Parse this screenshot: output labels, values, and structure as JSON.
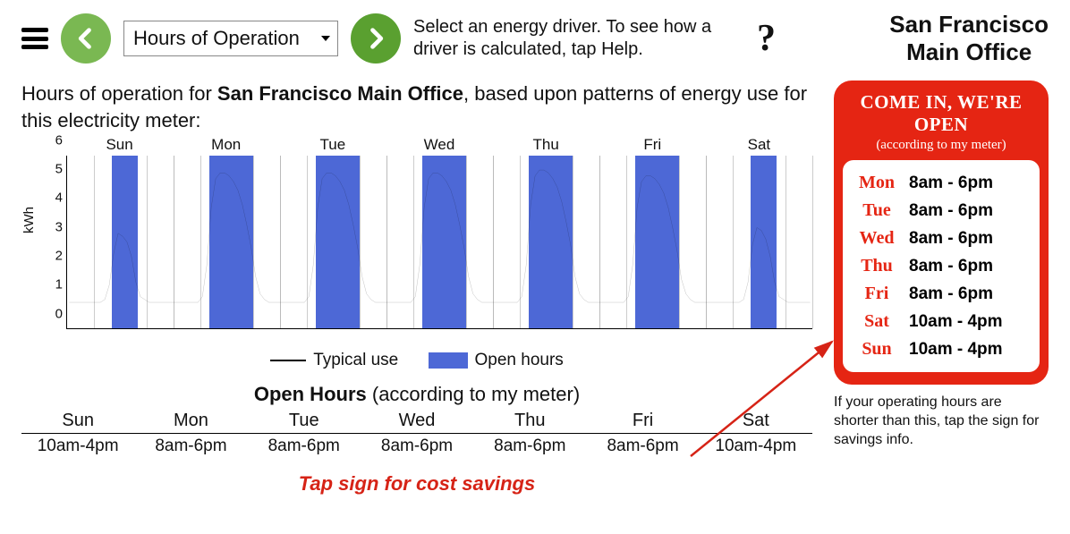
{
  "header": {
    "driver_selected": "Hours of Operation",
    "instructions": "Select an energy driver. To see how a driver is calculated, tap Help.",
    "site_line1": "San Francisco",
    "site_line2": "Main Office"
  },
  "description": {
    "prefix": "Hours of operation for ",
    "site": "San Francisco Main Office",
    "suffix": ", based upon patterns of energy use for this electricity meter:"
  },
  "chart_data": {
    "type": "line+bar",
    "ylabel": "kWh",
    "ylim": [
      0,
      6
    ],
    "yticks": [
      0,
      1,
      2,
      3,
      4,
      5,
      6
    ],
    "days": [
      "Sun",
      "Mon",
      "Tue",
      "Wed",
      "Thu",
      "Fri",
      "Sat"
    ],
    "hours_per_day": 24,
    "open_windows": [
      {
        "day": "Sun",
        "start": 10,
        "end": 16
      },
      {
        "day": "Mon",
        "start": 8,
        "end": 18
      },
      {
        "day": "Tue",
        "start": 8,
        "end": 18
      },
      {
        "day": "Wed",
        "start": 8,
        "end": 18
      },
      {
        "day": "Thu",
        "start": 8,
        "end": 18
      },
      {
        "day": "Fri",
        "start": 8,
        "end": 18
      },
      {
        "day": "Sat",
        "start": 10,
        "end": 16
      }
    ],
    "typical_use_hourly": {
      "Sun": [
        0.9,
        0.9,
        0.9,
        0.9,
        0.9,
        0.9,
        0.9,
        0.9,
        1.0,
        1.5,
        2.6,
        3.3,
        3.2,
        3.0,
        2.5,
        1.6,
        1.1,
        1.0,
        0.9,
        0.9,
        0.9,
        0.9,
        0.9,
        0.9
      ],
      "Mon": [
        0.9,
        0.9,
        0.9,
        0.9,
        0.9,
        0.9,
        1.1,
        2.2,
        4.2,
        5.2,
        5.4,
        5.4,
        5.3,
        5.1,
        4.8,
        4.3,
        3.6,
        2.8,
        1.8,
        1.2,
        1.0,
        0.9,
        0.9,
        0.9
      ],
      "Tue": [
        0.9,
        0.9,
        0.9,
        0.9,
        0.9,
        0.9,
        1.1,
        2.2,
        4.2,
        5.2,
        5.4,
        5.4,
        5.3,
        5.1,
        4.8,
        4.3,
        3.6,
        2.8,
        1.8,
        1.2,
        1.0,
        0.9,
        0.9,
        0.9
      ],
      "Wed": [
        0.9,
        0.9,
        0.9,
        0.9,
        0.9,
        0.9,
        1.1,
        2.2,
        4.2,
        5.2,
        5.4,
        5.4,
        5.3,
        5.1,
        4.8,
        4.3,
        3.6,
        2.8,
        1.8,
        1.2,
        1.0,
        0.9,
        0.9,
        0.9
      ],
      "Thu": [
        0.9,
        0.9,
        0.9,
        0.9,
        0.9,
        0.9,
        1.1,
        2.2,
        4.3,
        5.3,
        5.5,
        5.5,
        5.4,
        5.2,
        4.9,
        4.4,
        3.7,
        2.9,
        1.8,
        1.2,
        1.0,
        0.9,
        0.9,
        0.9
      ],
      "Fri": [
        0.9,
        0.9,
        0.9,
        0.9,
        0.9,
        0.9,
        1.1,
        2.2,
        4.2,
        5.1,
        5.3,
        5.3,
        5.2,
        5.0,
        4.7,
        4.2,
        3.5,
        2.7,
        1.7,
        1.2,
        1.0,
        0.9,
        0.9,
        0.9
      ],
      "Sat": [
        0.9,
        0.9,
        0.9,
        0.9,
        0.9,
        0.9,
        0.9,
        0.9,
        1.0,
        1.6,
        2.9,
        3.5,
        3.4,
        3.1,
        2.5,
        1.6,
        1.1,
        1.0,
        0.9,
        0.9,
        0.9,
        0.9,
        0.9,
        0.9
      ]
    },
    "legend": {
      "line": "Typical use",
      "bar": "Open hours"
    }
  },
  "open_hours_table": {
    "title_bold": "Open Hours",
    "title_rest": " (according to my meter)",
    "rows": [
      {
        "day": "Sun",
        "hours": "10am-4pm"
      },
      {
        "day": "Mon",
        "hours": "8am-6pm"
      },
      {
        "day": "Tue",
        "hours": "8am-6pm"
      },
      {
        "day": "Wed",
        "hours": "8am-6pm"
      },
      {
        "day": "Thu",
        "hours": "8am-6pm"
      },
      {
        "day": "Fri",
        "hours": "8am-6pm"
      },
      {
        "day": "Sat",
        "hours": "10am-4pm"
      }
    ]
  },
  "tap_sign": "Tap sign for cost savings",
  "sign": {
    "title": "COME IN, WE'RE OPEN",
    "sub": "(according to my meter)",
    "rows": [
      {
        "day": "Mon",
        "hours": "8am - 6pm"
      },
      {
        "day": "Tue",
        "hours": "8am - 6pm"
      },
      {
        "day": "Wed",
        "hours": "8am - 6pm"
      },
      {
        "day": "Thu",
        "hours": "8am - 6pm"
      },
      {
        "day": "Fri",
        "hours": "8am - 6pm"
      },
      {
        "day": "Sat",
        "hours": "10am - 4pm"
      },
      {
        "day": "Sun",
        "hours": "10am - 4pm"
      }
    ],
    "hint": "If your operating hours are shorter than this, tap the sign for savings info."
  }
}
